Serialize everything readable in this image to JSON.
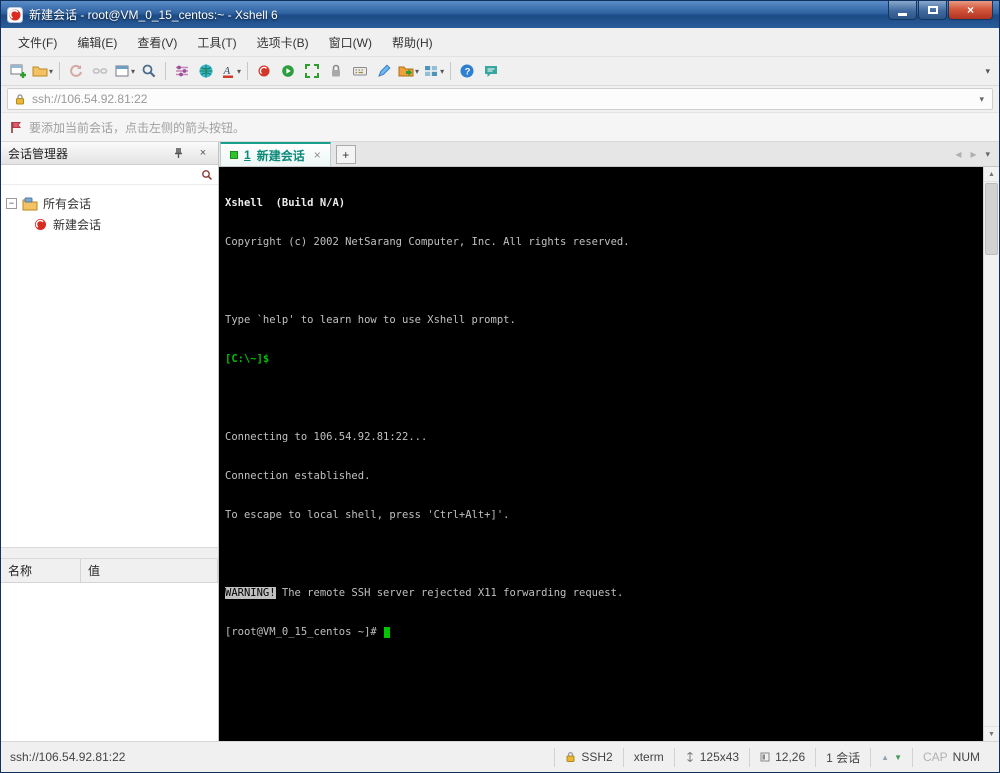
{
  "window": {
    "title": "新建会话 - root@VM_0_15_centos:~ - Xshell 6"
  },
  "icons": {
    "close": "×",
    "caret_down": "▾",
    "nav_prev": "◂",
    "nav_next": "▸",
    "scroll_up": "▲",
    "scroll_down": "▼",
    "add": "+",
    "expander_collapse": "−"
  },
  "menu": {
    "items": [
      {
        "label": "文件(F)"
      },
      {
        "label": "编辑(E)"
      },
      {
        "label": "查看(V)"
      },
      {
        "label": "工具(T)"
      },
      {
        "label": "选项卡(B)"
      },
      {
        "label": "窗口(W)"
      },
      {
        "label": "帮助(H)"
      }
    ]
  },
  "toolbar": {
    "buttons": [
      "new-session",
      "open-sessions",
      "reconnect",
      "disconnect",
      "new-terminal",
      "find",
      "properties",
      "web",
      "font-color",
      "record",
      "play",
      "fullscreen",
      "lock-screen",
      "virtual-keypad",
      "compose",
      "file-transfer",
      "layout",
      "help",
      "feedback"
    ]
  },
  "address": {
    "value": "ssh://106.54.92.81:22"
  },
  "info": {
    "text": "要添加当前会话，点击左侧的箭头按钮。"
  },
  "sidebar": {
    "title": "会话管理器",
    "tree": {
      "root_label": "所有会话",
      "session_label": "新建会话"
    },
    "table": {
      "name_header": "名称",
      "value_header": "值"
    }
  },
  "tabs": {
    "active_number": "1",
    "active_label": "新建会话"
  },
  "terminal": {
    "banner_title": "Xshell  (Build N/A)",
    "copyright": "Copyright (c) 2002 NetSarang Computer, Inc. All rights reserved.",
    "help_hint": "Type `help' to learn how to use Xshell prompt.",
    "local_prompt": "[C:\\~]$ ",
    "connecting": "Connecting to 106.54.92.81:22...",
    "established": "Connection established.",
    "escape_hint": "To escape to local shell, press 'Ctrl+Alt+]'.",
    "warning_label": "WARNING!",
    "warning_rest": " The remote SSH server rejected X11 forwarding request.",
    "remote_prompt": "[root@VM_0_15_centos ~]# "
  },
  "status": {
    "left": "ssh://106.54.92.81:22",
    "protocol": "SSH2",
    "terminal_type": "xterm",
    "screen_size": "125x43",
    "cursor_position": "12,26",
    "session_count": "1 会话",
    "caps_indicator": "CAP",
    "num_indicator": "NUM"
  },
  "colors": {
    "accent_teal": "#18a08c",
    "terminal_green": "#00c400",
    "terminal_fg": "#c0c0c0",
    "terminal_bg": "#000000",
    "titlebar_blue": "#2e62a1",
    "close_red": "#c03524"
  }
}
